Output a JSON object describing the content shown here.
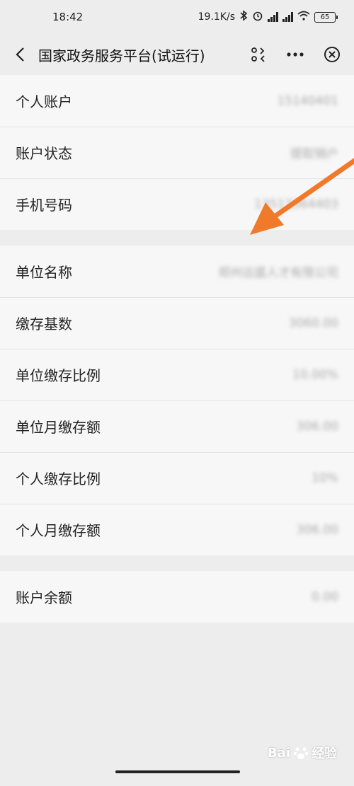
{
  "status_bar": {
    "time": "18:42",
    "net_speed": "19.1K/s",
    "battery": "65"
  },
  "nav": {
    "title": "国家政务服务平台(试运行)"
  },
  "groups": [
    {
      "rows": [
        {
          "label": "个人账户",
          "value": "15140401"
        },
        {
          "label": "账户状态",
          "value": "提取销户"
        },
        {
          "label": "手机号码",
          "value": "13513364403"
        }
      ]
    },
    {
      "rows": [
        {
          "label": "单位名称",
          "value": "郑州远盛人才有限公司"
        },
        {
          "label": "缴存基数",
          "value": "3060.00"
        },
        {
          "label": "单位缴存比例",
          "value": "10.00%"
        },
        {
          "label": "单位月缴存额",
          "value": "306.00"
        },
        {
          "label": "个人缴存比例",
          "value": "10%"
        },
        {
          "label": "个人月缴存额",
          "value": "306.00"
        }
      ]
    },
    {
      "rows": [
        {
          "label": "账户余额",
          "value": "0.00"
        }
      ]
    }
  ],
  "watermark": {
    "text": "Bai",
    "suffix": "经验"
  },
  "colors": {
    "arrow": "#f07a2a",
    "page_bg": "#ededed",
    "row_bg": "#f7f7f7"
  }
}
